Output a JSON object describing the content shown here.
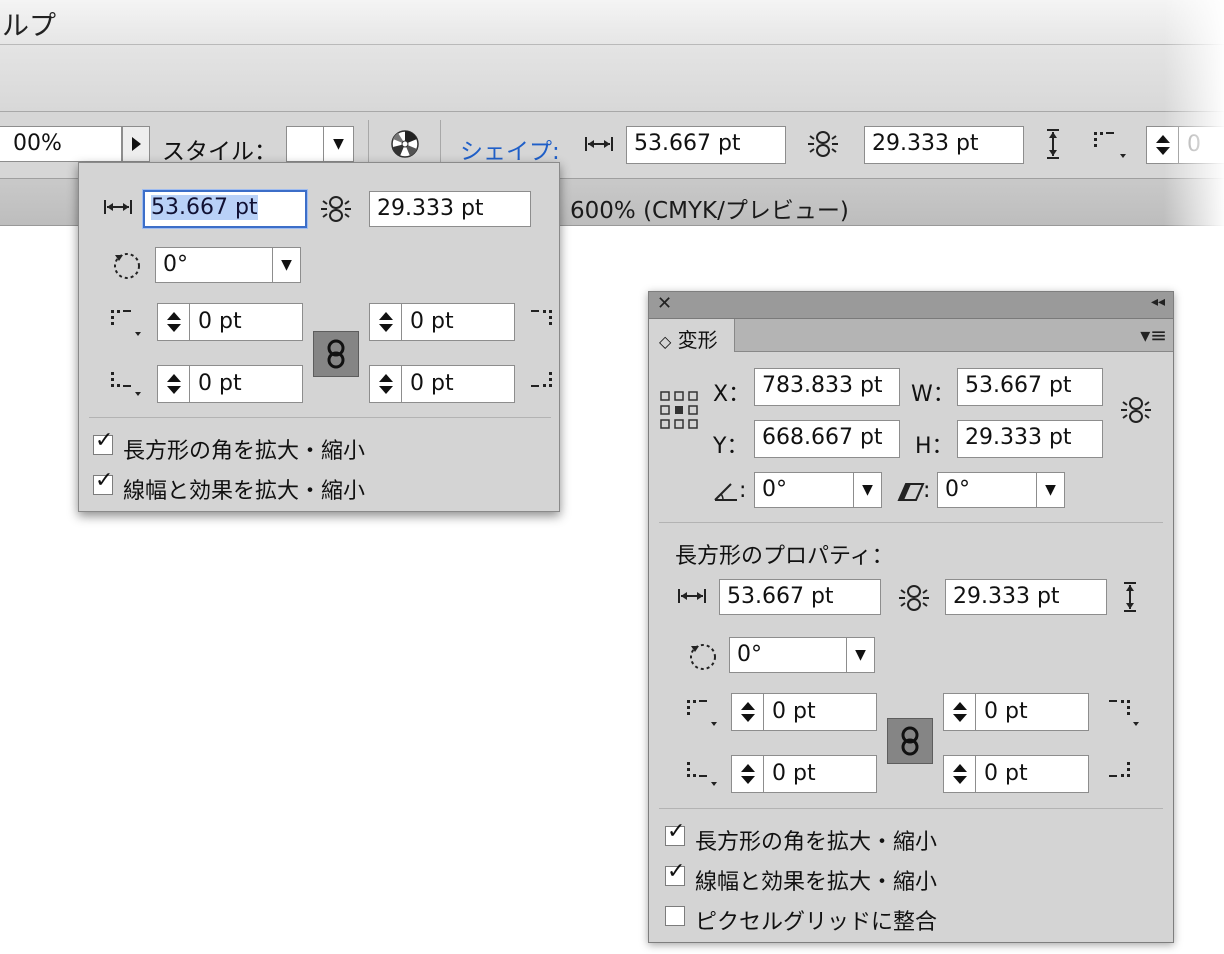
{
  "app": {
    "menu_title_fragment": "ルプ",
    "document_tab_zoom": "600% (CMYK/プレビュー)"
  },
  "control_bar": {
    "opacity_value": "00%",
    "style_label": "スタイル：",
    "shape_link_label": "シェイプ:",
    "width_value": "53.667 pt",
    "height_value": "29.333 pt",
    "corner_value_fragment": "0"
  },
  "shape_popover": {
    "width_value": "53.667 pt",
    "height_value": "29.333 pt",
    "rotation_value": "0°",
    "corner_top_left": "0 pt",
    "corner_top_right": "0 pt",
    "corner_bottom_left": "0 pt",
    "corner_bottom_right": "0 pt",
    "scale_corners_label": "長方形の角を拡大・縮小",
    "scale_corners_checked": true,
    "scale_strokes_label": "線幅と効果を拡大・縮小",
    "scale_strokes_checked": true
  },
  "transform_panel": {
    "tab_label": "変形",
    "x_label": "X：",
    "x_value": "783.833 pt",
    "y_label": "Y：",
    "y_value": "668.667 pt",
    "w_label": "W：",
    "w_value": "53.667 pt",
    "h_label": "H：",
    "h_value": "29.333 pt",
    "angle_value": "0°",
    "shear_value": "0°",
    "rect_props_label": "長方形のプロパティ：",
    "rect_width_value": "53.667 pt",
    "rect_height_value": "29.333 pt",
    "rect_rotation_value": "0°",
    "corner_top_left": "0 pt",
    "corner_top_right": "0 pt",
    "corner_bottom_left": "0 pt",
    "corner_bottom_right": "0 pt",
    "scale_corners_label": "長方形の角を拡大・縮小",
    "scale_corners_checked": true,
    "scale_strokes_label": "線幅と効果を拡大・縮小",
    "scale_strokes_checked": true,
    "pixel_grid_label": "ピクセルグリッドに整合",
    "pixel_grid_checked": false
  },
  "colors": {
    "link_blue": "#1f5fc8",
    "focus_border": "#3c6ec8",
    "selection": "#b9d1f7",
    "panel_bg": "#d4d4d4"
  }
}
